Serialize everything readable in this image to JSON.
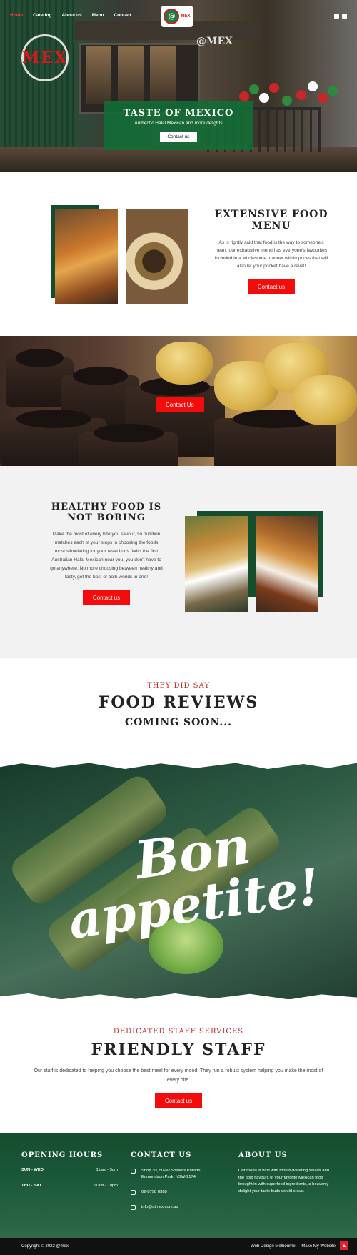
{
  "nav": {
    "items": [
      {
        "label": "Home"
      },
      {
        "label": "Catering"
      },
      {
        "label": "About us"
      },
      {
        "label": "Menu"
      },
      {
        "label": "Contact"
      }
    ],
    "logo_mark": "@",
    "logo_text": "MEX"
  },
  "hero": {
    "title": "TASTE OF MEXICO",
    "subtitle": "Authentic Halal Mexican and more delights",
    "button": "Contact us",
    "storefront_sign": "MEX",
    "store_sign_small": "@MEX"
  },
  "menu_section": {
    "title": "EXTENSIVE FOOD MENU",
    "body": "As is rightly said that food is the way to someone's heart, our exhaustive menu has everyone's favourites included in a wholesome manner within prices that will also let your pocket have a revel!",
    "button": "Contact us"
  },
  "cakes_section": {
    "button": "Contact Us"
  },
  "healthy_section": {
    "title": "HEALTHY FOOD IS NOT BORING",
    "body": "Make the most of every bite you savour, so nutrition matches each of your steps in choosing the foods most stimulating for your taste buds. With the first Australian Halal Mexican near you, you don't have to go anywhere. No more choosing between healthy and tasty, get the best of both worlds in one!",
    "button": "Contact us"
  },
  "reviews": {
    "eyebrow": "THEY DID SAY",
    "title": "FOOD REVIEWS",
    "subtitle": "COMING SOON..."
  },
  "bon": {
    "line1": "Bon",
    "line2": "appetite!"
  },
  "staff": {
    "eyebrow": "DEDICATED STAFF SERVICES",
    "title": "FRIENDLY STAFF",
    "body": "Our staff is dedicated to helping you choose the best meal for every mood. They run a robust system helping you make the most of every bite.",
    "button": "Contact us"
  },
  "footer": {
    "hours_title": "OPENING HOURS",
    "hours": [
      {
        "days": "SUN - WED",
        "time": "11am - 9pm"
      },
      {
        "days": "THU - SAT",
        "time": "11am - 10pm"
      }
    ],
    "contact_title": "CONTACT US",
    "address": "Shop 30, 50-60 Soldiers Parade, Edmondson Park, NSW-2174",
    "phone": "02-8798 8388",
    "email": "info@atmex.com.au",
    "about_title": "ABOUT US",
    "about_text": "Our menu is vast with mouth-watering salads and the bold flavours of your favorite Mexican food brought in with superfood ingredients, a heavenly delight your taste buds would crave."
  },
  "bottom_bar": {
    "copyright": "Copyright © 2022 @mex",
    "credit": "Web Design Melbourne -",
    "credit_brand": "Make My Website"
  },
  "colors": {
    "accent": "#f20c0c",
    "brand_green": "#154e2c"
  },
  "icons": [
    "facebook-icon",
    "instagram-icon",
    "map-pin-icon",
    "phone-icon",
    "mail-icon",
    "arrow-up-icon"
  ]
}
